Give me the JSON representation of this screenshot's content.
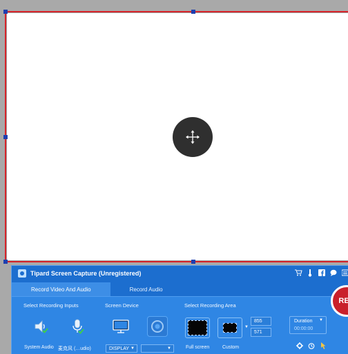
{
  "app": {
    "title": "Tipard Screen Capture (Unregistered)"
  },
  "tabs": [
    {
      "label": "Record Video And Audio",
      "active": true
    },
    {
      "label": "Record Audio",
      "active": false
    }
  ],
  "sections": {
    "inputs": "Select Recording Inputs",
    "device": "Screen Device",
    "area": "Select Recording Area"
  },
  "inputs": {
    "system_audio": "System Audio",
    "microphone": "麦克风 (…udio)"
  },
  "device": {
    "display_select": "DISPLAY",
    "second_select": ""
  },
  "area": {
    "full_screen": "Full screen",
    "custom": "Custom",
    "width": "855",
    "height": "571"
  },
  "duration": {
    "label": "Duration",
    "value": "00:00:00"
  },
  "record_button": "REC",
  "icons": {
    "title_bar": [
      "cart-icon",
      "thermometer-icon",
      "facebook-icon",
      "chat-icon",
      "menu-icon"
    ],
    "bottom": [
      "gear-icon",
      "alarm-icon",
      "cursor-icon"
    ]
  },
  "colors": {
    "toolbar": "#1c6ecf",
    "panel": "#2f86e4",
    "capture_border": "#d8242a",
    "handle": "#1e3fb0",
    "record": "#c9202b"
  }
}
